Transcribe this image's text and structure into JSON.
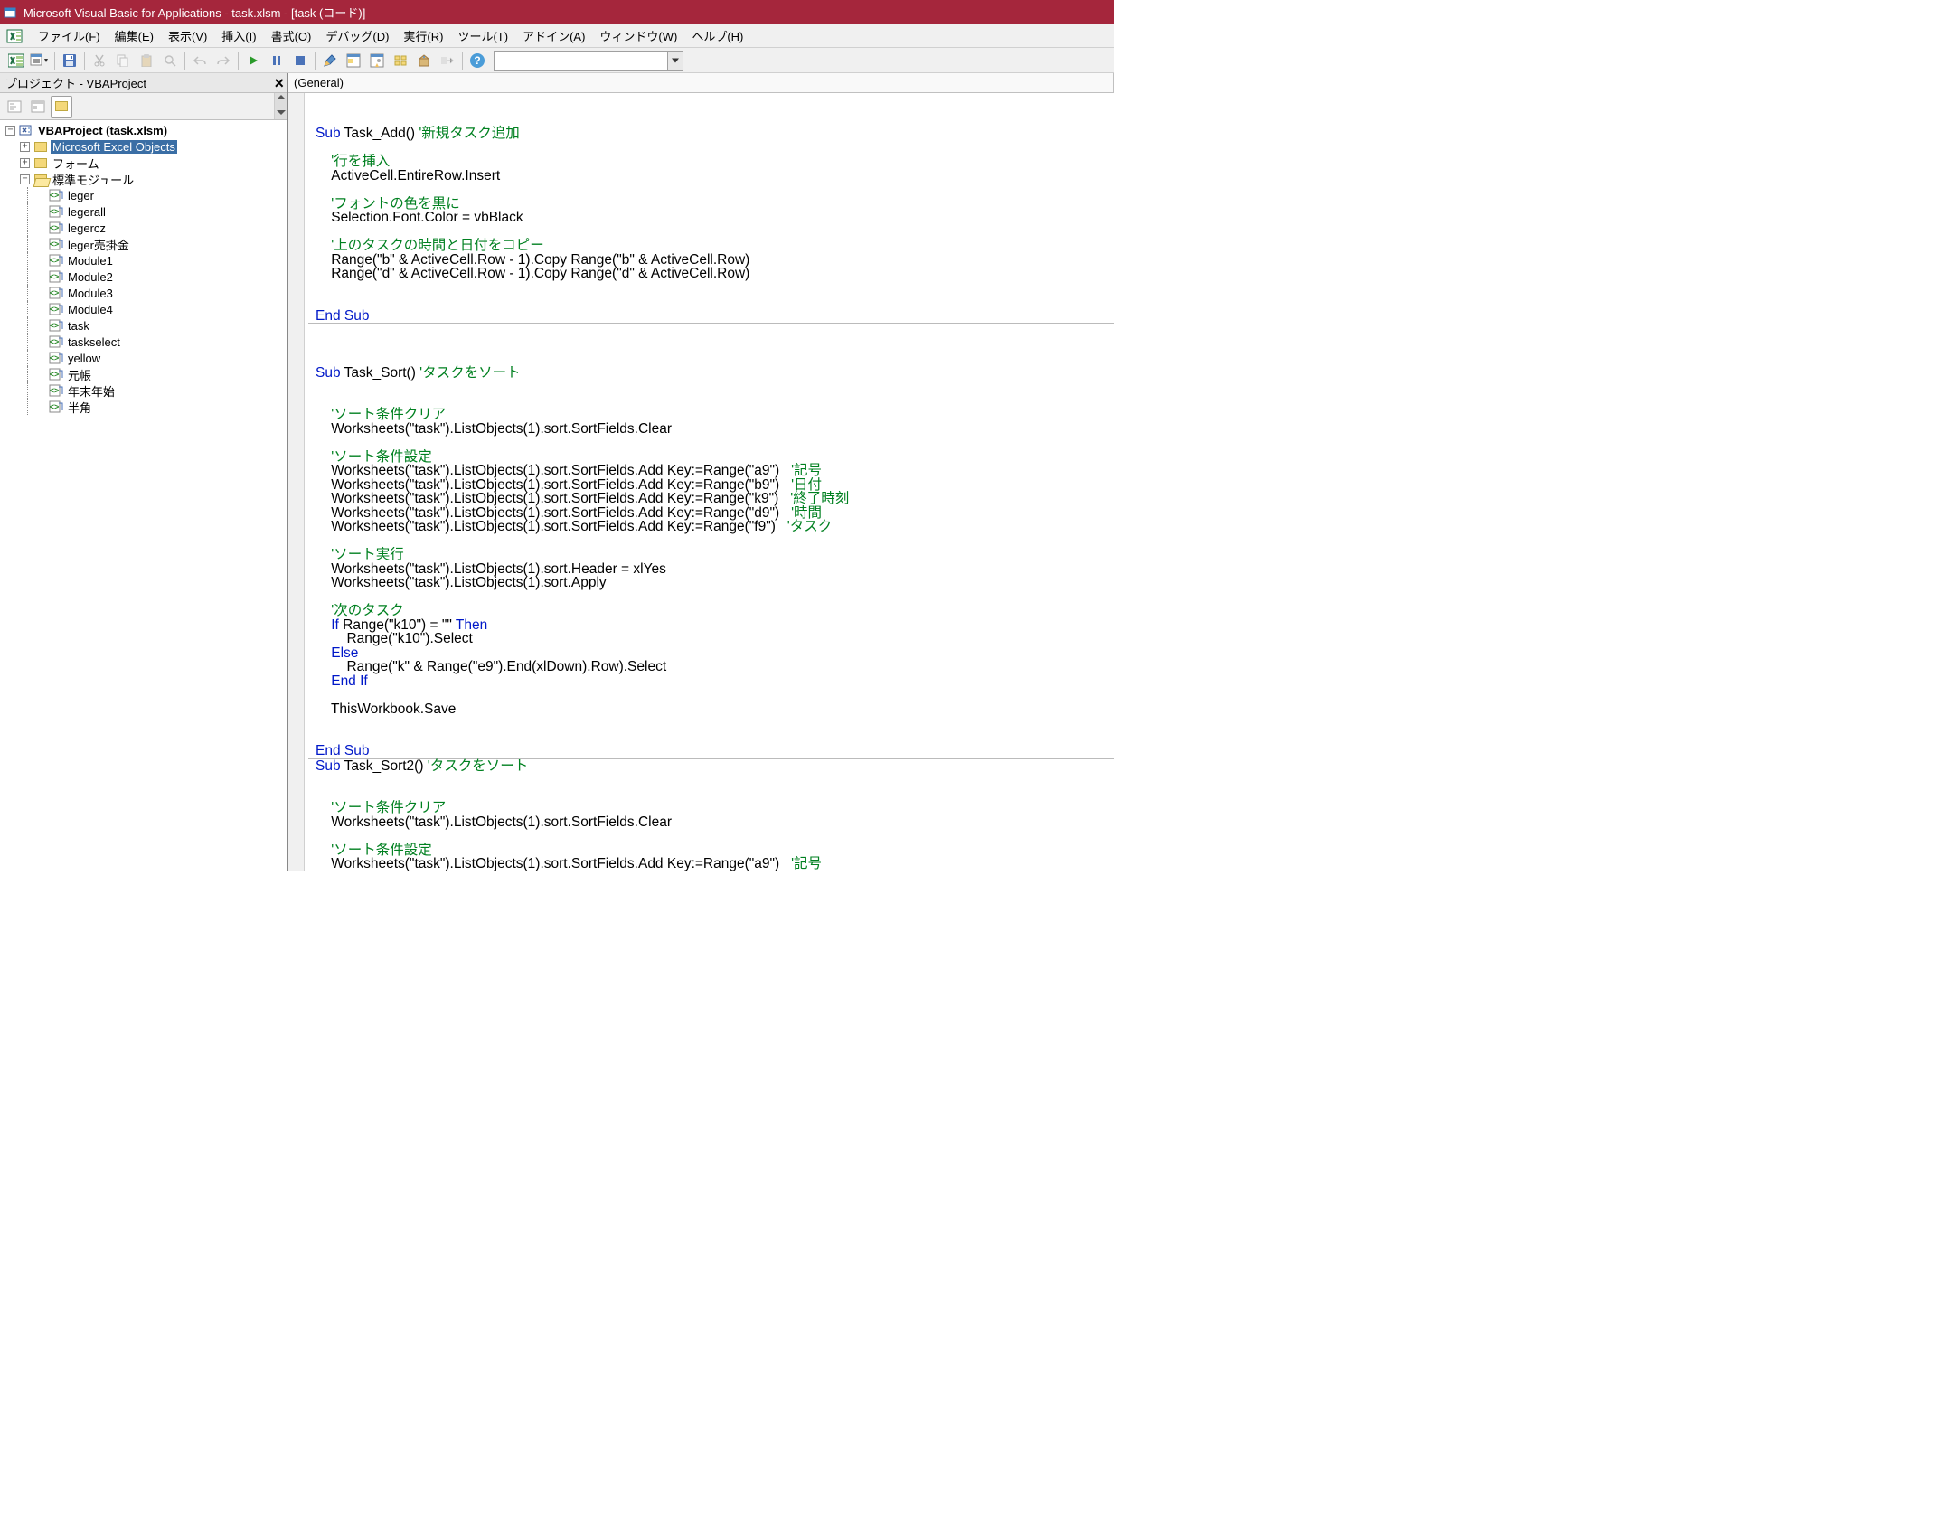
{
  "titlebar": {
    "text": "Microsoft Visual Basic for Applications - task.xlsm - [task (コード)]"
  },
  "menus": {
    "file": "ファイル(F)",
    "edit": "編集(E)",
    "view": "表示(V)",
    "insert": "挿入(I)",
    "format": "書式(O)",
    "debug": "デバッグ(D)",
    "run": "実行(R)",
    "tools": "ツール(T)",
    "addins": "アドイン(A)",
    "window": "ウィンドウ(W)",
    "help": "ヘルプ(H)"
  },
  "projectPanel": {
    "title": "プロジェクト - VBAProject"
  },
  "tree": {
    "root": "VBAProject (task.xlsm)",
    "excelObjects": "Microsoft Excel Objects",
    "forms": "フォーム",
    "modules": "標準モジュール",
    "items": [
      "leger",
      "legerall",
      "legercz",
      "leger売掛金",
      "Module1",
      "Module2",
      "Module3",
      "Module4",
      "task",
      "taskselect",
      "yellow",
      "元帳",
      "年末年始",
      "半角"
    ]
  },
  "codeHeader": {
    "left": "(General)"
  },
  "code": {
    "l01a": "Sub",
    "l01b": " Task_Add() ",
    "l01c": "'新規タスク追加",
    "l02": "    ",
    "l02c": "'行を挿入",
    "l03": "    ActiveCell.EntireRow.Insert",
    "l04": "    ",
    "l04c": "'フォントの色を黒に",
    "l05": "    Selection.Font.Color = vbBlack",
    "l06": "    ",
    "l06c": "'上のタスクの時間と日付をコピー",
    "l07": "    Range(\"b\" & ActiveCell.Row - 1).Copy Range(\"b\" & ActiveCell.Row)",
    "l08": "    Range(\"d\" & ActiveCell.Row - 1).Copy Range(\"d\" & ActiveCell.Row)",
    "l09a": "End Sub",
    "l20a": "Sub",
    "l20b": " Task_Sort() ",
    "l20c": "'タスクをソート",
    "l21": "    ",
    "l21c": "'ソート条件クリア",
    "l22": "    Worksheets(\"task\").ListObjects(1).sort.SortFields.Clear",
    "l23": "    ",
    "l23c": "'ソート条件設定",
    "l24a": "    Worksheets(\"task\").ListObjects(1).sort.SortFields.Add Key:=Range(\"a9\")   ",
    "l24c": "'記号",
    "l25a": "    Worksheets(\"task\").ListObjects(1).sort.SortFields.Add Key:=Range(\"b9\")   ",
    "l25c": "'日付",
    "l26a": "    Worksheets(\"task\").ListObjects(1).sort.SortFields.Add Key:=Range(\"k9\")   ",
    "l26c": "'終了時刻",
    "l27a": "    Worksheets(\"task\").ListObjects(1).sort.SortFields.Add Key:=Range(\"d9\")   ",
    "l27c": "'時間",
    "l28a": "    Worksheets(\"task\").ListObjects(1).sort.SortFields.Add Key:=Range(\"f9\")   ",
    "l28c": "'タスク",
    "l29": "    ",
    "l29c": "'ソート実行",
    "l30": "    Worksheets(\"task\").ListObjects(1).sort.Header = xlYes",
    "l31": "    Worksheets(\"task\").ListObjects(1).sort.Apply",
    "l32": "    ",
    "l32c": "'次のタスク",
    "l33a": "    ",
    "l33k1": "If",
    "l33b": " Range(\"k10\") = \"\" ",
    "l33k2": "Then",
    "l34": "        Range(\"k10\").Select",
    "l35k": "    Else",
    "l36": "        Range(\"k\" & Range(\"e9\").End(xlDown).Row).Select",
    "l37k": "    End If",
    "l38": "    ThisWorkbook.Save",
    "l39a": "End Sub",
    "l40a": "Sub",
    "l40b": " Task_Sort2() ",
    "l40c": "'タスクをソート",
    "l41": "    ",
    "l41c": "'ソート条件クリア",
    "l42": "    Worksheets(\"task\").ListObjects(1).sort.SortFields.Clear",
    "l43": "    ",
    "l43c": "'ソート条件設定",
    "l44a": "    Worksheets(\"task\").ListObjects(1).sort.SortFields.Add Key:=Range(\"a9\")   ",
    "l44c": "'記号"
  }
}
